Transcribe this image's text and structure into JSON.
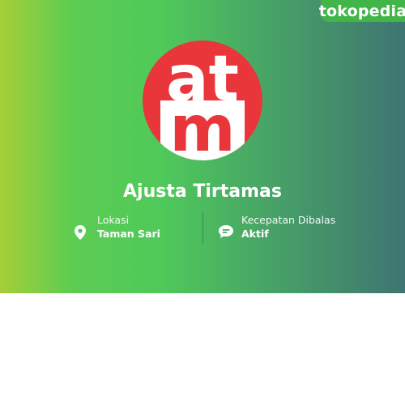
{
  "brand": {
    "name": "tokopedia"
  },
  "shop": {
    "name": "Ajusta Tirtamas",
    "logo_text_top": "at",
    "logo_text_bottom": "m"
  },
  "info": {
    "location": {
      "label": "Lokasi",
      "value": "Taman Sari",
      "icon": "map-pin-icon"
    },
    "response": {
      "label": "Kecepatan Dibalas",
      "value": "Aktif",
      "icon": "chat-bubble-icon"
    }
  },
  "colors": {
    "brand_green": "#42b549",
    "logo_red": "#e8363b",
    "text": "#ffffff"
  }
}
